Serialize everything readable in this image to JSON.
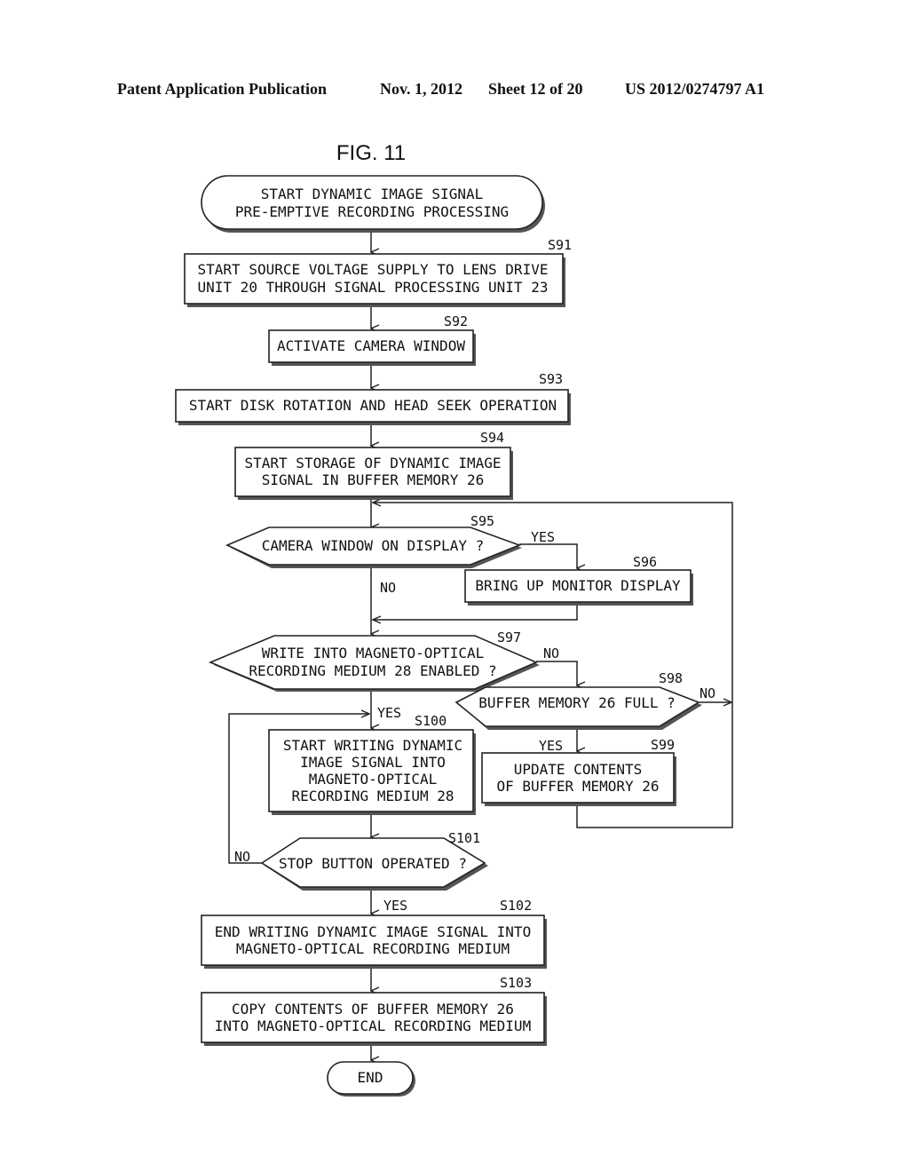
{
  "header": {
    "publication": "Patent Application Publication",
    "date": "Nov. 1, 2012",
    "sheet": "Sheet 12 of 20",
    "number": "US 2012/0274797 A1"
  },
  "figure": {
    "title": "FIG. 11"
  },
  "nodes": {
    "start": {
      "type": "terminal",
      "lines": [
        "START DYNAMIC IMAGE SIGNAL",
        "PRE-EMPTIVE RECORDING PROCESSING"
      ]
    },
    "s91": {
      "step": "S91",
      "type": "process",
      "lines": [
        "START SOURCE VOLTAGE SUPPLY TO LENS DRIVE",
        "UNIT 20 THROUGH SIGNAL PROCESSING UNIT 23"
      ]
    },
    "s92": {
      "step": "S92",
      "type": "process",
      "lines": [
        "ACTIVATE CAMERA WINDOW"
      ]
    },
    "s93": {
      "step": "S93",
      "type": "process",
      "lines": [
        "START DISK ROTATION AND HEAD SEEK OPERATION"
      ]
    },
    "s94": {
      "step": "S94",
      "type": "process",
      "lines": [
        "START STORAGE OF DYNAMIC IMAGE",
        "SIGNAL IN BUFFER MEMORY 26"
      ]
    },
    "s95": {
      "step": "S95",
      "type": "decision",
      "lines": [
        "CAMERA WINDOW ON DISPLAY ?"
      ]
    },
    "s96": {
      "step": "S96",
      "type": "process",
      "lines": [
        "BRING UP MONITOR DISPLAY"
      ]
    },
    "s97": {
      "step": "S97",
      "type": "decision",
      "lines": [
        "WRITE INTO MAGNETO-OPTICAL",
        "RECORDING MEDIUM 28 ENABLED ?"
      ]
    },
    "s98": {
      "step": "S98",
      "type": "decision",
      "lines": [
        "BUFFER MEMORY 26 FULL ?"
      ]
    },
    "s99": {
      "step": "S99",
      "type": "process",
      "lines": [
        "UPDATE CONTENTS",
        "OF BUFFER MEMORY 26"
      ]
    },
    "s100": {
      "step": "S100",
      "type": "process",
      "lines": [
        "START WRITING DYNAMIC",
        "IMAGE SIGNAL INTO",
        "MAGNETO-OPTICAL",
        "RECORDING MEDIUM 28"
      ]
    },
    "s101": {
      "step": "S101",
      "type": "decision",
      "lines": [
        "STOP BUTTON OPERATED ?"
      ]
    },
    "s102": {
      "step": "S102",
      "type": "process",
      "lines": [
        "END WRITING DYNAMIC IMAGE SIGNAL INTO",
        "MAGNETO-OPTICAL RECORDING MEDIUM"
      ]
    },
    "s103": {
      "step": "S103",
      "type": "process",
      "lines": [
        "COPY CONTENTS OF BUFFER MEMORY 26",
        "INTO MAGNETO-OPTICAL RECORDING MEDIUM"
      ]
    },
    "end": {
      "type": "terminal",
      "lines": [
        "END"
      ]
    }
  },
  "edge_labels": {
    "s95_yes": "YES",
    "s95_no": "NO",
    "s97_no": "NO",
    "s97_yes": "YES",
    "s98_no": "NO",
    "s98_yes": "YES",
    "s101_no": "NO",
    "s101_yes": "YES"
  }
}
